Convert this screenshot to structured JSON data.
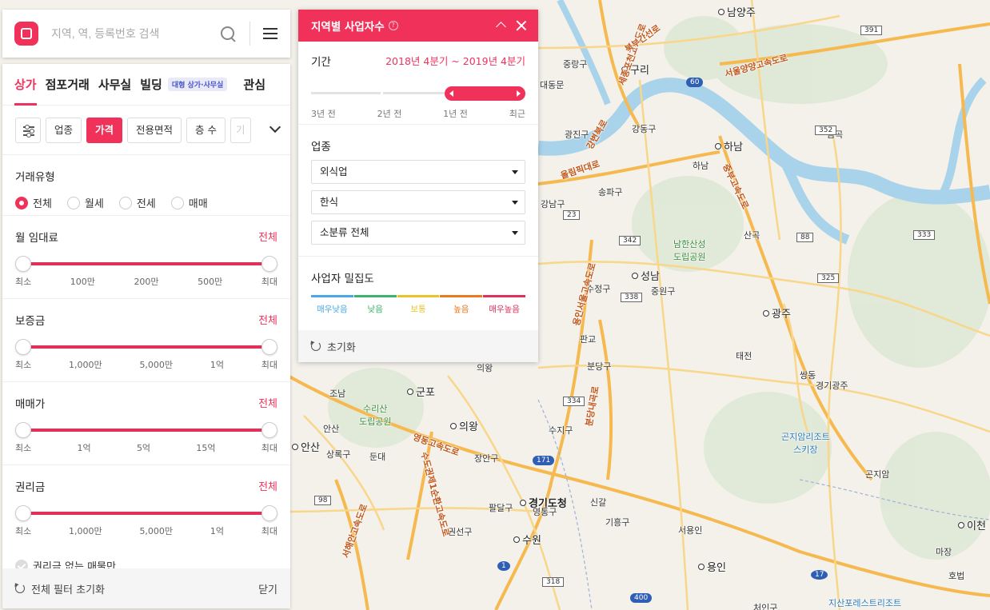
{
  "search": {
    "placeholder": "지역, 역, 등록번호 검색"
  },
  "tabs": [
    {
      "label": "상가"
    },
    {
      "label": "점포거래"
    },
    {
      "label": "사무실"
    },
    {
      "label": "빌딩"
    },
    {
      "label": "관심"
    }
  ],
  "tab_badge": "대형 상가·사무실",
  "chips": [
    "업종",
    "가격",
    "전용면적",
    "층 수",
    "기"
  ],
  "deal_type": {
    "title": "거래유형",
    "options": [
      "전체",
      "월세",
      "전세",
      "매매"
    ],
    "selected": "전체"
  },
  "sliders": [
    {
      "title": "월 임대료",
      "value_text": "전체",
      "ticks": [
        "최소",
        "100만",
        "200만",
        "500만",
        "최대"
      ]
    },
    {
      "title": "보증금",
      "value_text": "전체",
      "ticks": [
        "최소",
        "1,000만",
        "5,000만",
        "1억",
        "최대"
      ]
    },
    {
      "title": "매매가",
      "value_text": "전체",
      "ticks": [
        "최소",
        "1억",
        "5억",
        "15억",
        "최대"
      ]
    },
    {
      "title": "권리금",
      "value_text": "전체",
      "ticks": [
        "최소",
        "1,000만",
        "5,000만",
        "1억",
        "최대"
      ]
    }
  ],
  "no_premium_label": "권리금 없는 매물만",
  "footer": {
    "reset_label": "전체 필터 초기화",
    "close_label": "닫기"
  },
  "regional": {
    "title": "지역별 사업자수",
    "help": "?",
    "period_label": "기간",
    "period_value": "2018년 4분기 ~ 2019년 4분기",
    "period_ticks": [
      "3년 전",
      "2년 전",
      "1년 전",
      "최근"
    ],
    "biz_label": "업종",
    "selects": [
      "외식업",
      "한식",
      "소분류 전체"
    ],
    "density_label": "사업자 밀집도",
    "legend": [
      {
        "label": "매우낮음",
        "color": "#4aa8e8"
      },
      {
        "label": "낮음",
        "color": "#3bb36a"
      },
      {
        "label": "보통",
        "color": "#e8c42a"
      },
      {
        "label": "높음",
        "color": "#e87a22"
      },
      {
        "label": "매우높음",
        "color": "#e0315b"
      }
    ],
    "reset_label": "초기화"
  },
  "map": {
    "cities": [
      "남양주",
      "구리",
      "하남",
      "성남",
      "광주",
      "군포",
      "의왕",
      "안산",
      "경기도청",
      "수원",
      "용인",
      "이천"
    ],
    "districts": [
      "중랑구",
      "광진구",
      "강동구",
      "송파구",
      "강남구",
      "수정구",
      "중원구",
      "분당구",
      "수지구",
      "장안구",
      "팔달구",
      "영통구",
      "권선구",
      "기흥구",
      "상록구",
      "처인구"
    ],
    "places": [
      "하남",
      "산곡",
      "판교",
      "태전",
      "쌍동",
      "경기광주",
      "신갈",
      "서용인",
      "마장",
      "호법",
      "곤지암",
      "금곡",
      "둔대",
      "안산",
      "조남",
      "의왕",
      "대동문"
    ],
    "parks": [
      "남한산성\n도립공원",
      "수리산\n도립공원"
    ],
    "resorts": [
      "곤지암리조트\n스키장",
      "지산포레스트리조트"
    ],
    "highways": [
      "세종포천고속도로",
      "북부간선로",
      "서울양양고속도로",
      "강변북로",
      "올림픽대로",
      "중부고속도로",
      "용인서울고속도로",
      "분당내곡로",
      "영동고속도로",
      "서해안고속도로",
      "수도권제1순환고속도로"
    ],
    "route_numbers": [
      "391",
      "60",
      "352",
      "88",
      "333",
      "325",
      "342",
      "23",
      "338",
      "334",
      "171",
      "98",
      "1",
      "318",
      "17",
      "400"
    ],
    "colors": {
      "land": "#f3f1ea",
      "river": "#a8d3ea",
      "forest": "#dfe8d6",
      "highway": "#f6b94f",
      "road": "#f8d68a"
    }
  }
}
